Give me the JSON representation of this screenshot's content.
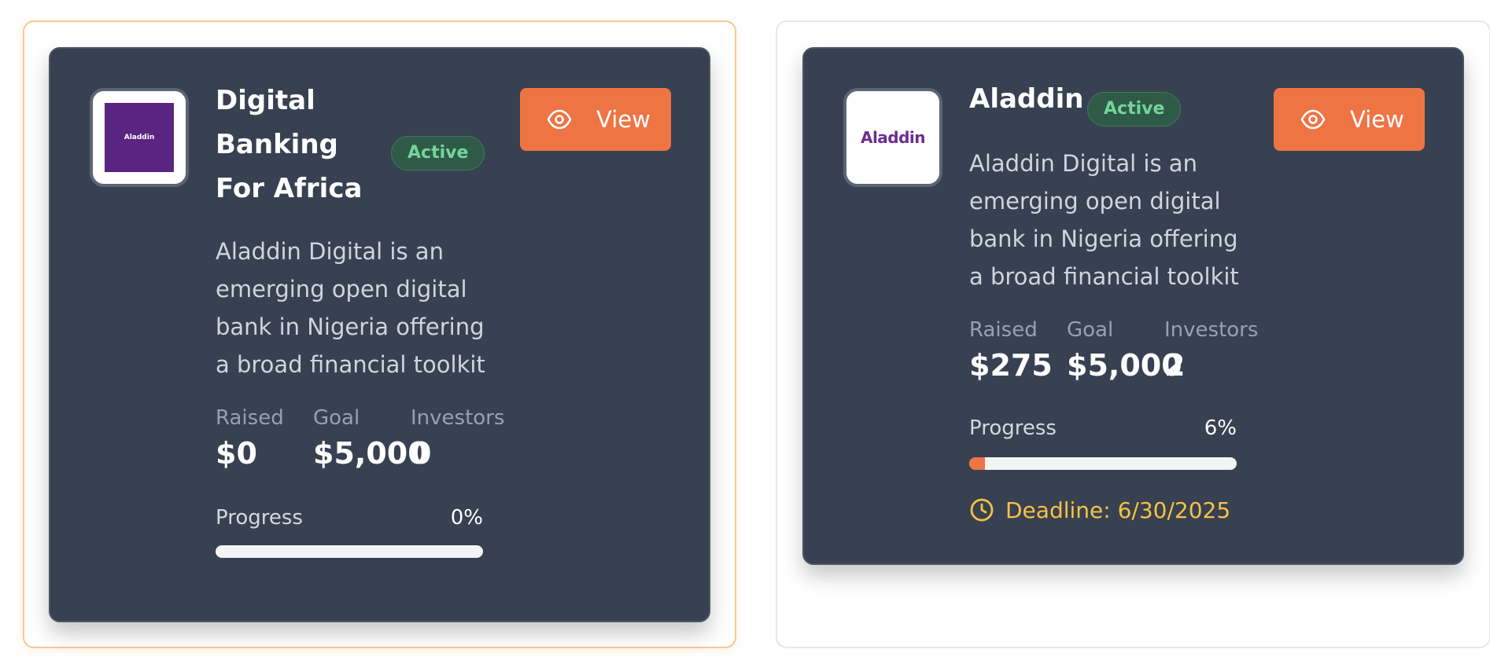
{
  "cards": [
    {
      "logo_text": "Aladdin",
      "title_lines": [
        "Digital",
        "Banking",
        "For Africa"
      ],
      "status": "Active",
      "view_label": "View",
      "description_lines": [
        "Aladdin Digital is an",
        "emerging open digital",
        "bank in Nigeria offering",
        "a broad financial toolkit"
      ],
      "stats": {
        "raised_label": "Raised",
        "raised_value": "$0",
        "goal_label": "Goal",
        "goal_value": "$5,000",
        "investors_label": "Investors",
        "investors_value": "0"
      },
      "progress_label": "Progress",
      "progress_text": "0%",
      "progress_fraction": 0.0
    },
    {
      "logo_text": "Aladdin",
      "title_lines": [
        "Aladdin"
      ],
      "status": "Active",
      "view_label": "View",
      "description_lines": [
        "Aladdin Digital is an",
        "emerging open digital",
        "bank in Nigeria offering",
        "a broad financial toolkit"
      ],
      "stats": {
        "raised_label": "Raised",
        "raised_value": "$275",
        "goal_label": "Goal",
        "goal_value": "$5,000",
        "investors_label": "Investors",
        "investors_value": "2"
      },
      "progress_label": "Progress",
      "progress_text": "6%",
      "progress_fraction": 0.06,
      "deadline": "Deadline: 6/30/2025"
    }
  ],
  "colors": {
    "card_bg": "#374151",
    "accent": "#ef7444",
    "status_green": "#74d49a",
    "deadline_yellow": "#f7c244"
  }
}
